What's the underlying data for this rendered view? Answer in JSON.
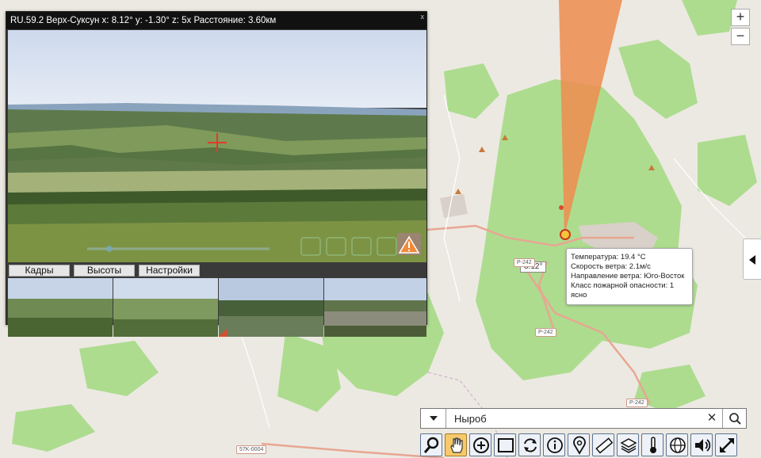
{
  "camera": {
    "title": "RU.59.2 Верх-Суксун x: 8.12° y: -1.30° z: 5x Расстояние: 3.60км",
    "close_label": "x",
    "tabs": [
      {
        "label": "Кадры"
      },
      {
        "label": "Высоты"
      },
      {
        "label": "Настройки"
      }
    ]
  },
  "map": {
    "zoom_in_label": "+",
    "zoom_out_label": "−",
    "bearing_label": "8.12°",
    "road_labels": [
      "P-242",
      "P-242",
      "P-242",
      "57K-0004"
    ],
    "colors": {
      "land": "#ece9e2",
      "forest": "#addc8f",
      "road": "#e8a692",
      "fire_sector": "#ef8c4e",
      "water": "#aad3df"
    }
  },
  "weather": {
    "lines": [
      "Температура: 19.4 °C",
      "Скорость ветра: 2.1м/с",
      "Направление ветра: Юго-Восток",
      "Класс пожарной опасности: 1",
      "ясно"
    ]
  },
  "search": {
    "value": "Ныроб",
    "clear_label": "✕"
  },
  "toolbar": {
    "tools": [
      {
        "icon": "search-icon"
      },
      {
        "icon": "hand-icon"
      },
      {
        "icon": "add-circle-icon"
      },
      {
        "icon": "square-select-icon"
      },
      {
        "icon": "rotate-icon"
      },
      {
        "icon": "info-icon"
      },
      {
        "icon": "map-pin-icon"
      },
      {
        "icon": "ruler-icon"
      },
      {
        "icon": "layers-icon"
      },
      {
        "icon": "thermometer-icon"
      },
      {
        "icon": "globe-icon"
      },
      {
        "icon": "sound-icon"
      },
      {
        "icon": "fullscreen-icon"
      }
    ]
  }
}
